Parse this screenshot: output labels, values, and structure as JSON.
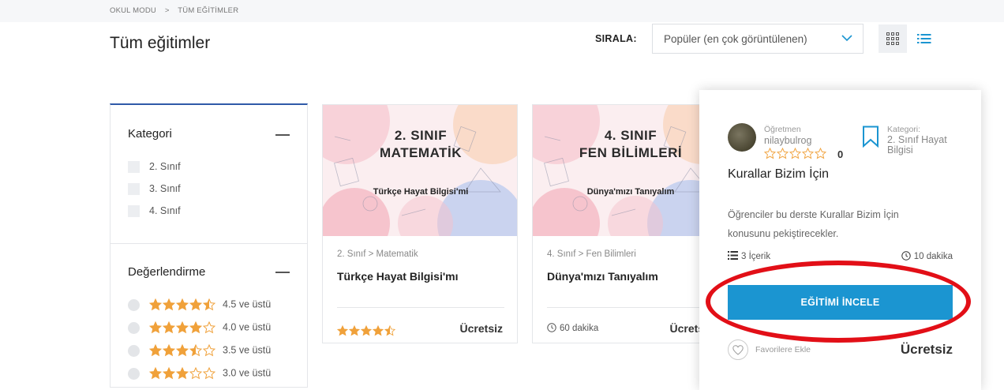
{
  "breadcrumb": {
    "home": "OKUL MODU",
    "separator": ">",
    "current": "TÜM EĞİTİMLER"
  },
  "page_title": "Tüm eğitimler",
  "sort": {
    "label": "SIRALA:",
    "selected": "Popüler (en çok görüntülenen)"
  },
  "filters": {
    "category": {
      "title": "Kategori",
      "options": [
        "2. Sınıf",
        "3. Sınıf",
        "4. Sınıf"
      ]
    },
    "rating": {
      "title": "Değerlendirme",
      "options": [
        "4.5 ve üstü",
        "4.0 ve üstü",
        "3.5 ve üstü",
        "3.0 ve üstü"
      ],
      "star_values": [
        4.5,
        4.0,
        3.5,
        3.0
      ]
    }
  },
  "cards": [
    {
      "thumb_title_line1": "2. SINIF",
      "thumb_title_line2": "MATEMATİK",
      "thumb_subtitle": "Türkçe Hayat Bilgisi'mi",
      "category": "2. Sınıf > Matematik",
      "title": "Türkçe Hayat Bilgisi'mı",
      "rating": 4.5,
      "price": "Ücretsiz"
    },
    {
      "thumb_title_line1": "4. SINIF",
      "thumb_title_line2": "FEN BİLİMLERİ",
      "thumb_subtitle": "Dünya'mızı Tanıyalım",
      "category": "4. Sınıf > Fen Bilimleri",
      "title": "Dünya'mızı Tanıyalım",
      "duration": "60 dakika",
      "price": "Ücretsiz"
    }
  ],
  "popup": {
    "teacher_label": "Öğretmen",
    "teacher_name": "nilaybulrog",
    "rating_count": "0",
    "category_label": "Kategori:",
    "category_value": "2. Sınıf Hayat Bilgisi",
    "title": "Kurallar Bizim İçin",
    "description": "Öğrenciler bu derste Kurallar Bizim İçin konusunu pekiştirecekler.",
    "content_count": "3 İçerik",
    "duration": "10 dakika",
    "button_label": "EĞİTİMİ İNCELE",
    "favorite_label": "Favorilere Ekle",
    "price": "Ücretsiz"
  },
  "colors": {
    "accent_blue": "#1b95d1",
    "star_orange": "#f0a13a",
    "highlight_red": "#e20f17",
    "filter_top_border": "#2f5aa8"
  },
  "icons": [
    "chevron-down-icon",
    "grid-view-icon",
    "list-view-icon",
    "star-icon",
    "bookmark-icon",
    "list-icon",
    "clock-icon",
    "heart-icon"
  ]
}
